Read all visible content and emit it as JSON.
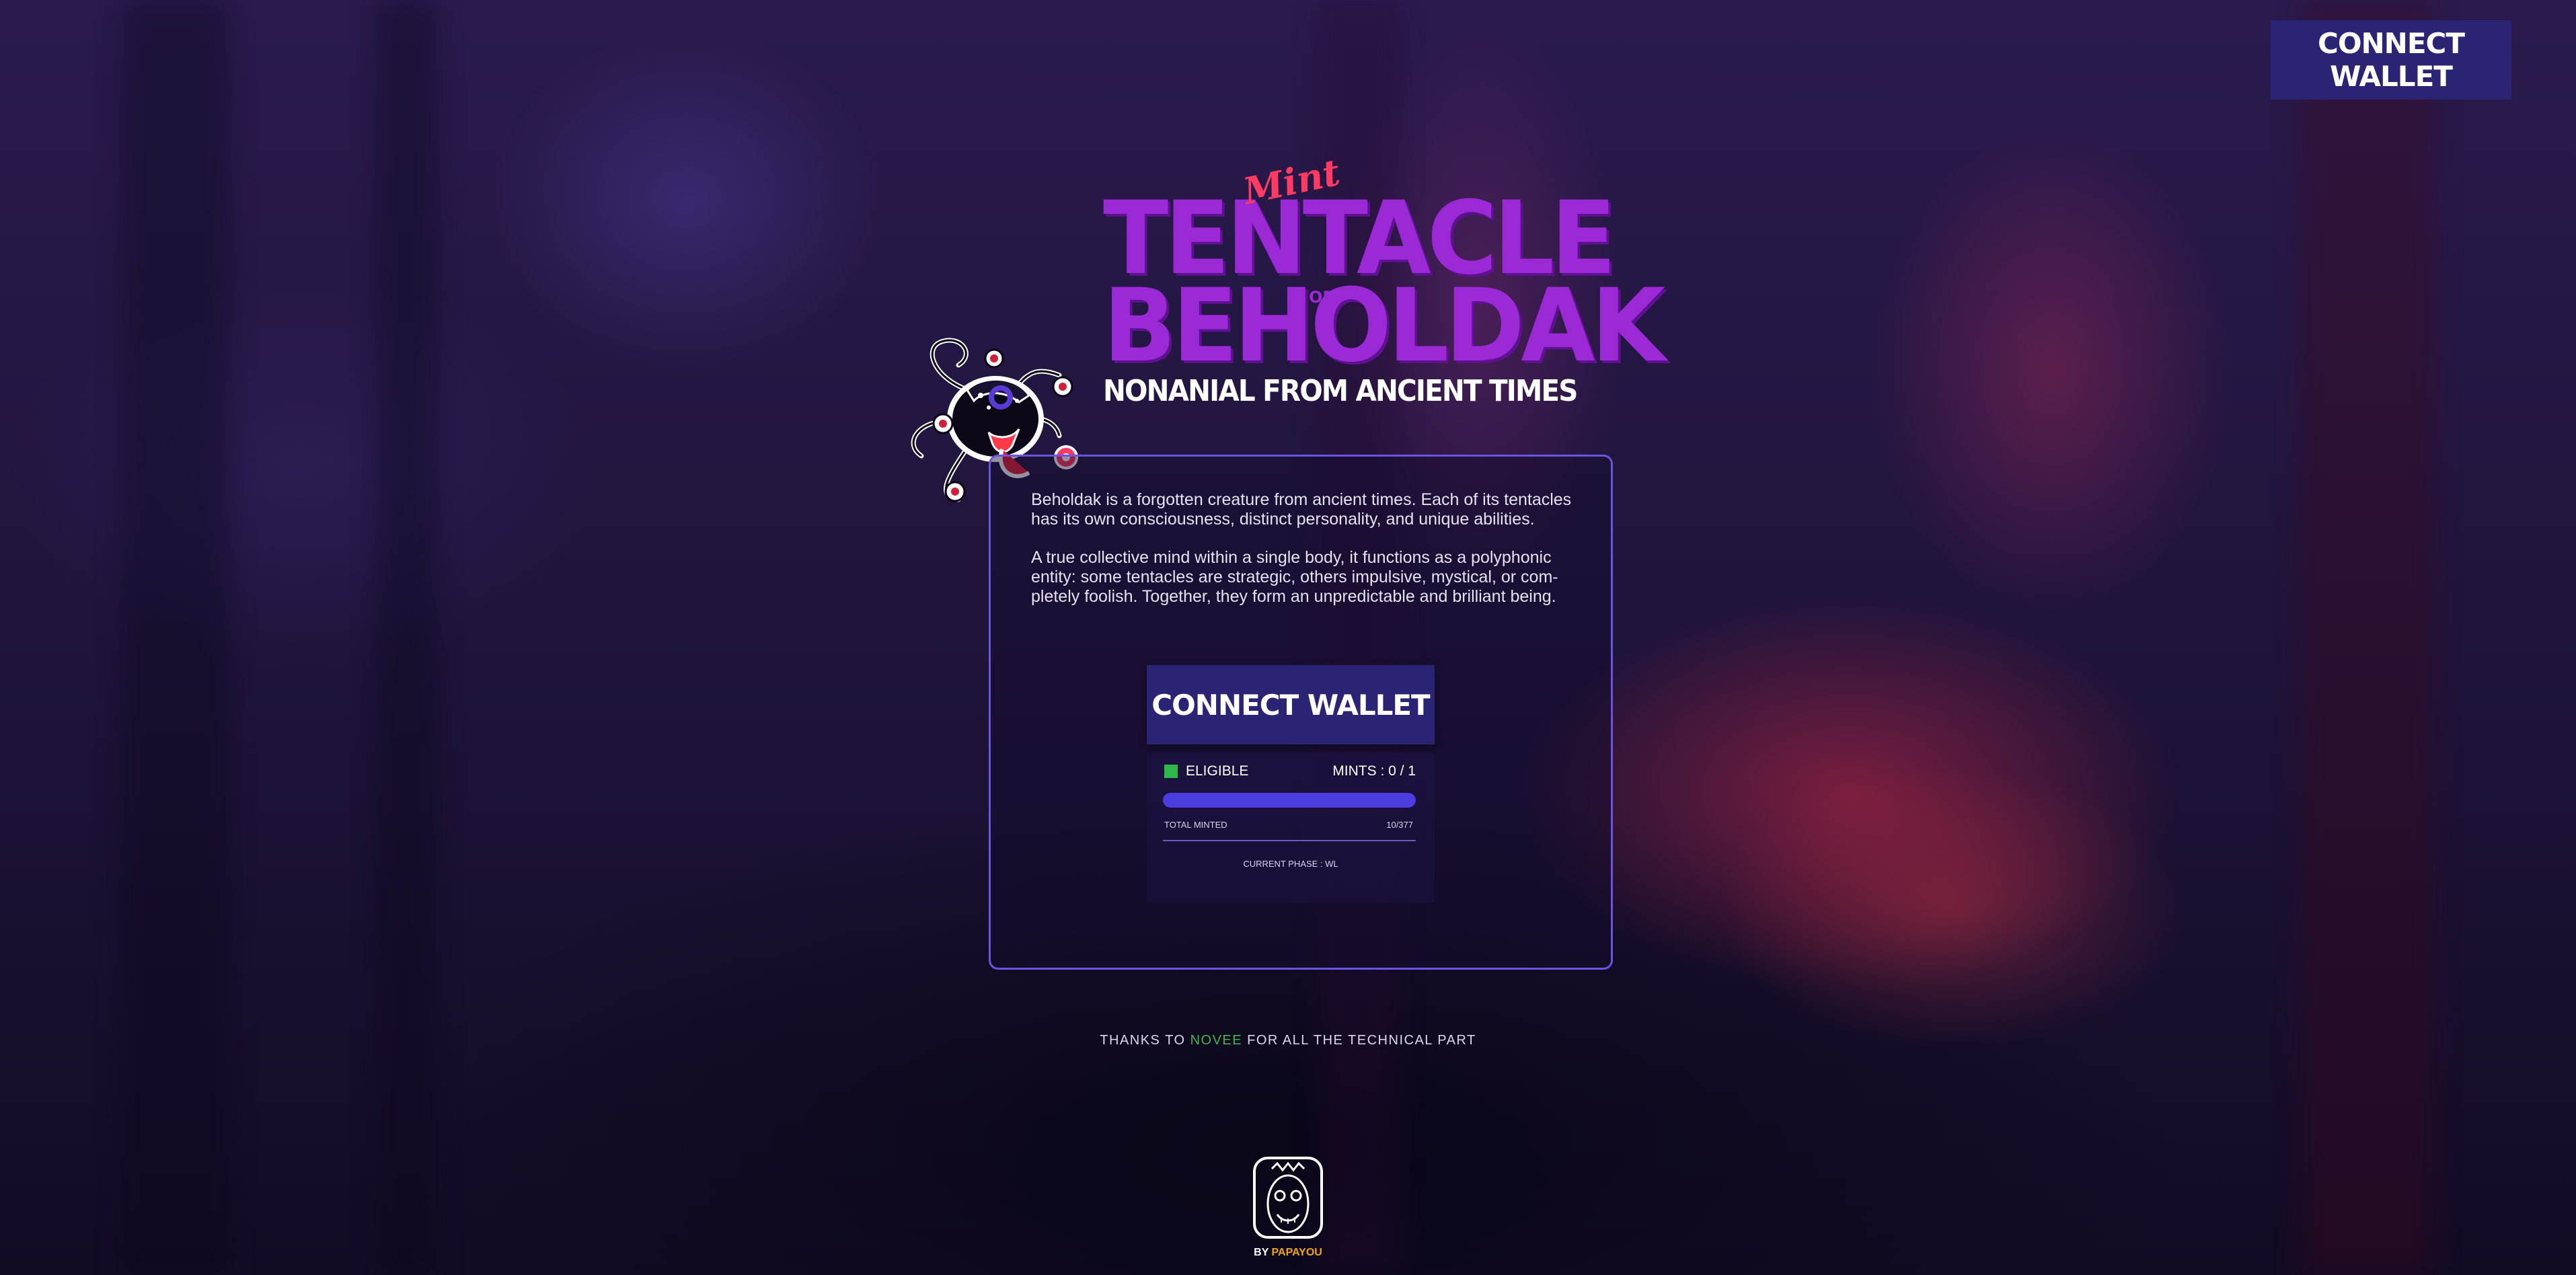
{
  "header": {
    "connect_wallet_label": "CONNECT WALLET"
  },
  "logo": {
    "mint": "Mint",
    "title_line1": "TENTACLE",
    "of": "OF",
    "title_line2": "BEHOLDAK",
    "subtitle": "NONANIAL FROM ANCIENT TIMES"
  },
  "panel": {
    "paragraph1": "Beholdak is a forgotten creature from ancient times. Each of its tentacles has its own consciousness, distinct personality, and unique abilities.",
    "paragraph2": "A true collective mind within a single body, it functions as a polyphonic entity: some tentacles are strategic, others impulsive, mystical, or com-pletely foolish. Together, they form an unpredictable and brilliant being.",
    "connect_wallet_label": "CONNECT WALLET",
    "status": {
      "eligibility": "ELIGIBLE",
      "mints": "MINTS : 0 / 1",
      "progress_fraction": 1.0,
      "total_minted_label": "TOTAL MINTED",
      "total_minted_value": "10/377",
      "phase": "CURRENT PHASE : WL"
    }
  },
  "footer": {
    "thanks_prefix": "THANKS TO",
    "thanks_name": "NOVEE",
    "thanks_suffix": "FOR ALL THE TECHNICAL PART",
    "by_prefix": "BY",
    "by_name": "PAPAYOU"
  },
  "colors": {
    "button_bg": "#2b2475",
    "panel_border": "#6b55e0",
    "eligible_green": "#2fb84a",
    "novee_green": "#3fb84d",
    "papayou_orange": "#f2a51c",
    "title_purple": "#9b2ad6",
    "mint_red": "#ff3a63"
  },
  "icons": {
    "mascot": "beholdak-creature-icon",
    "footer": "papayou-mask-icon"
  }
}
